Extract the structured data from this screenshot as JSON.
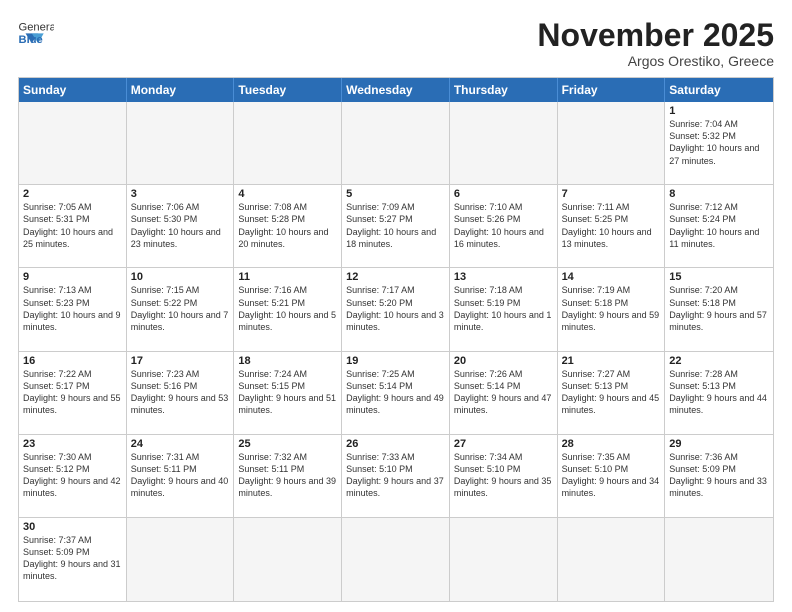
{
  "header": {
    "logo_general": "General",
    "logo_blue": "Blue",
    "month_title": "November 2025",
    "location": "Argos Orestiko, Greece"
  },
  "day_headers": [
    "Sunday",
    "Monday",
    "Tuesday",
    "Wednesday",
    "Thursday",
    "Friday",
    "Saturday"
  ],
  "cells": [
    {
      "day": "",
      "empty": true,
      "info": ""
    },
    {
      "day": "",
      "empty": true,
      "info": ""
    },
    {
      "day": "",
      "empty": true,
      "info": ""
    },
    {
      "day": "",
      "empty": true,
      "info": ""
    },
    {
      "day": "",
      "empty": true,
      "info": ""
    },
    {
      "day": "",
      "empty": true,
      "info": ""
    },
    {
      "day": "1",
      "empty": false,
      "info": "Sunrise: 7:04 AM\nSunset: 5:32 PM\nDaylight: 10 hours and 27 minutes."
    },
    {
      "day": "2",
      "empty": false,
      "info": "Sunrise: 7:05 AM\nSunset: 5:31 PM\nDaylight: 10 hours and 25 minutes."
    },
    {
      "day": "3",
      "empty": false,
      "info": "Sunrise: 7:06 AM\nSunset: 5:30 PM\nDaylight: 10 hours and 23 minutes."
    },
    {
      "day": "4",
      "empty": false,
      "info": "Sunrise: 7:08 AM\nSunset: 5:28 PM\nDaylight: 10 hours and 20 minutes."
    },
    {
      "day": "5",
      "empty": false,
      "info": "Sunrise: 7:09 AM\nSunset: 5:27 PM\nDaylight: 10 hours and 18 minutes."
    },
    {
      "day": "6",
      "empty": false,
      "info": "Sunrise: 7:10 AM\nSunset: 5:26 PM\nDaylight: 10 hours and 16 minutes."
    },
    {
      "day": "7",
      "empty": false,
      "info": "Sunrise: 7:11 AM\nSunset: 5:25 PM\nDaylight: 10 hours and 13 minutes."
    },
    {
      "day": "8",
      "empty": false,
      "info": "Sunrise: 7:12 AM\nSunset: 5:24 PM\nDaylight: 10 hours and 11 minutes."
    },
    {
      "day": "9",
      "empty": false,
      "info": "Sunrise: 7:13 AM\nSunset: 5:23 PM\nDaylight: 10 hours and 9 minutes."
    },
    {
      "day": "10",
      "empty": false,
      "info": "Sunrise: 7:15 AM\nSunset: 5:22 PM\nDaylight: 10 hours and 7 minutes."
    },
    {
      "day": "11",
      "empty": false,
      "info": "Sunrise: 7:16 AM\nSunset: 5:21 PM\nDaylight: 10 hours and 5 minutes."
    },
    {
      "day": "12",
      "empty": false,
      "info": "Sunrise: 7:17 AM\nSunset: 5:20 PM\nDaylight: 10 hours and 3 minutes."
    },
    {
      "day": "13",
      "empty": false,
      "info": "Sunrise: 7:18 AM\nSunset: 5:19 PM\nDaylight: 10 hours and 1 minute."
    },
    {
      "day": "14",
      "empty": false,
      "info": "Sunrise: 7:19 AM\nSunset: 5:18 PM\nDaylight: 9 hours and 59 minutes."
    },
    {
      "day": "15",
      "empty": false,
      "info": "Sunrise: 7:20 AM\nSunset: 5:18 PM\nDaylight: 9 hours and 57 minutes."
    },
    {
      "day": "16",
      "empty": false,
      "info": "Sunrise: 7:22 AM\nSunset: 5:17 PM\nDaylight: 9 hours and 55 minutes."
    },
    {
      "day": "17",
      "empty": false,
      "info": "Sunrise: 7:23 AM\nSunset: 5:16 PM\nDaylight: 9 hours and 53 minutes."
    },
    {
      "day": "18",
      "empty": false,
      "info": "Sunrise: 7:24 AM\nSunset: 5:15 PM\nDaylight: 9 hours and 51 minutes."
    },
    {
      "day": "19",
      "empty": false,
      "info": "Sunrise: 7:25 AM\nSunset: 5:14 PM\nDaylight: 9 hours and 49 minutes."
    },
    {
      "day": "20",
      "empty": false,
      "info": "Sunrise: 7:26 AM\nSunset: 5:14 PM\nDaylight: 9 hours and 47 minutes."
    },
    {
      "day": "21",
      "empty": false,
      "info": "Sunrise: 7:27 AM\nSunset: 5:13 PM\nDaylight: 9 hours and 45 minutes."
    },
    {
      "day": "22",
      "empty": false,
      "info": "Sunrise: 7:28 AM\nSunset: 5:13 PM\nDaylight: 9 hours and 44 minutes."
    },
    {
      "day": "23",
      "empty": false,
      "info": "Sunrise: 7:30 AM\nSunset: 5:12 PM\nDaylight: 9 hours and 42 minutes."
    },
    {
      "day": "24",
      "empty": false,
      "info": "Sunrise: 7:31 AM\nSunset: 5:11 PM\nDaylight: 9 hours and 40 minutes."
    },
    {
      "day": "25",
      "empty": false,
      "info": "Sunrise: 7:32 AM\nSunset: 5:11 PM\nDaylight: 9 hours and 39 minutes."
    },
    {
      "day": "26",
      "empty": false,
      "info": "Sunrise: 7:33 AM\nSunset: 5:10 PM\nDaylight: 9 hours and 37 minutes."
    },
    {
      "day": "27",
      "empty": false,
      "info": "Sunrise: 7:34 AM\nSunset: 5:10 PM\nDaylight: 9 hours and 35 minutes."
    },
    {
      "day": "28",
      "empty": false,
      "info": "Sunrise: 7:35 AM\nSunset: 5:10 PM\nDaylight: 9 hours and 34 minutes."
    },
    {
      "day": "29",
      "empty": false,
      "info": "Sunrise: 7:36 AM\nSunset: 5:09 PM\nDaylight: 9 hours and 33 minutes."
    },
    {
      "day": "30",
      "empty": false,
      "info": "Sunrise: 7:37 AM\nSunset: 5:09 PM\nDaylight: 9 hours and 31 minutes."
    },
    {
      "day": "",
      "empty": true,
      "info": ""
    },
    {
      "day": "",
      "empty": true,
      "info": ""
    },
    {
      "day": "",
      "empty": true,
      "info": ""
    },
    {
      "day": "",
      "empty": true,
      "info": ""
    },
    {
      "day": "",
      "empty": true,
      "info": ""
    },
    {
      "day": "",
      "empty": true,
      "info": ""
    }
  ]
}
